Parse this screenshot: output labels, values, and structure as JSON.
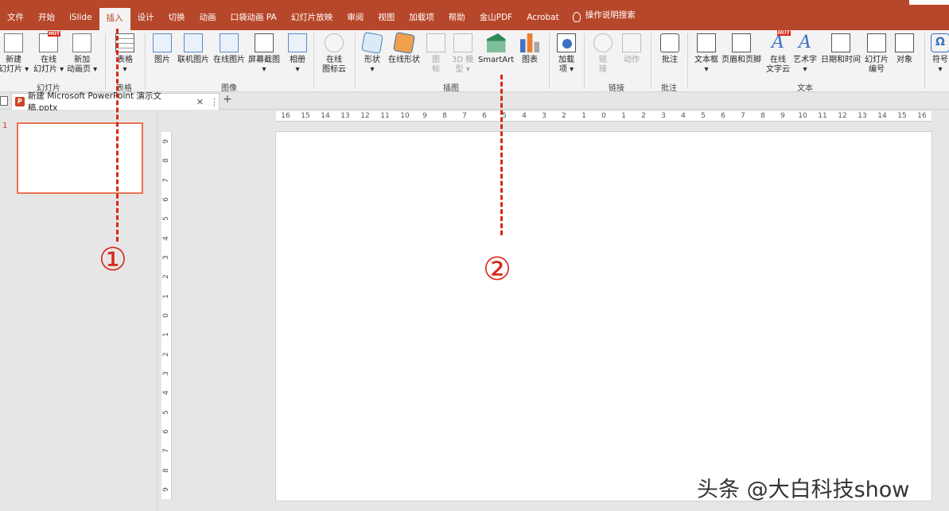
{
  "tabs": [
    "文件",
    "开始",
    "iSlide",
    "插入",
    "设计",
    "切换",
    "动画",
    "口袋动画 PA",
    "幻灯片放映",
    "审阅",
    "视图",
    "加载项",
    "帮助",
    "金山PDF",
    "Acrobat"
  ],
  "active_tab_index": 3,
  "search_label": "操作说明搜索",
  "ribbon": {
    "new_slide": [
      "新建",
      "幻灯片 ▾"
    ],
    "online_slide": [
      "在线",
      "幻灯片 ▾"
    ],
    "new_anim_page": [
      "新加",
      "动画页 ▾"
    ],
    "group_slides": "幻灯片",
    "table": [
      "表格",
      "▾"
    ],
    "group_table": "表格",
    "picture": "图片",
    "online_picture_lib": "联机图片",
    "online_picture": "在线图片",
    "screenshot": [
      "屏幕截图",
      "▾"
    ],
    "album": [
      "相册",
      "▾"
    ],
    "group_images": "图像",
    "online_icon_cloud": [
      "在线",
      "图标云"
    ],
    "shapes": [
      "形状",
      "▾"
    ],
    "online_shapes": "在线形状",
    "icons": [
      "图",
      "标"
    ],
    "model_3d": [
      "3D 模",
      "型 ▾"
    ],
    "smartart": "SmartArt",
    "chart": "图表",
    "group_illustrations": "插图",
    "addins": [
      "加载",
      "项 ▾"
    ],
    "link": [
      "链",
      "接"
    ],
    "action": "动作",
    "group_links": "链接",
    "comment": "批注",
    "group_comments": "批注",
    "textbox": [
      "文本框",
      "▾"
    ],
    "header_footer": "页眉和页脚",
    "online_text_cloud": [
      "在线",
      "文字云"
    ],
    "wordart": [
      "艺术字",
      "▾"
    ],
    "date_time": "日期和时间",
    "slide_number": [
      "幻灯片",
      "编号"
    ],
    "object": "对象",
    "group_text": "文本",
    "symbol": [
      "符号",
      "▾"
    ],
    "hot_badge": "HOT"
  },
  "document": {
    "tab_title": "新建 Microsoft PowerPoint 演示文稿.pptx",
    "close_glyph": "✕",
    "more_glyph": "⋮",
    "add_glyph": "+",
    "app_badge": "P"
  },
  "thumbnail": {
    "number": "1"
  },
  "hruler_labels": [
    "16",
    "15",
    "14",
    "13",
    "12",
    "11",
    "10",
    "9",
    "8",
    "7",
    "6",
    "5",
    "4",
    "3",
    "2",
    "1",
    "0",
    "1",
    "2",
    "3",
    "4",
    "5",
    "6",
    "7",
    "8",
    "9",
    "10",
    "11",
    "12",
    "13",
    "14",
    "15",
    "16"
  ],
  "vruler_labels": [
    "9",
    "8",
    "7",
    "6",
    "5",
    "4",
    "3",
    "2",
    "1",
    "0",
    "1",
    "2",
    "3",
    "4",
    "5",
    "6",
    "7",
    "8",
    "9"
  ],
  "annotations": {
    "marker_1": "①",
    "marker_2": "②"
  },
  "watermark": "头条 @大白科技show",
  "colors": {
    "accent": "#b7472a",
    "annotation": "#d9281a",
    "thumb_border": "#e8734f"
  }
}
